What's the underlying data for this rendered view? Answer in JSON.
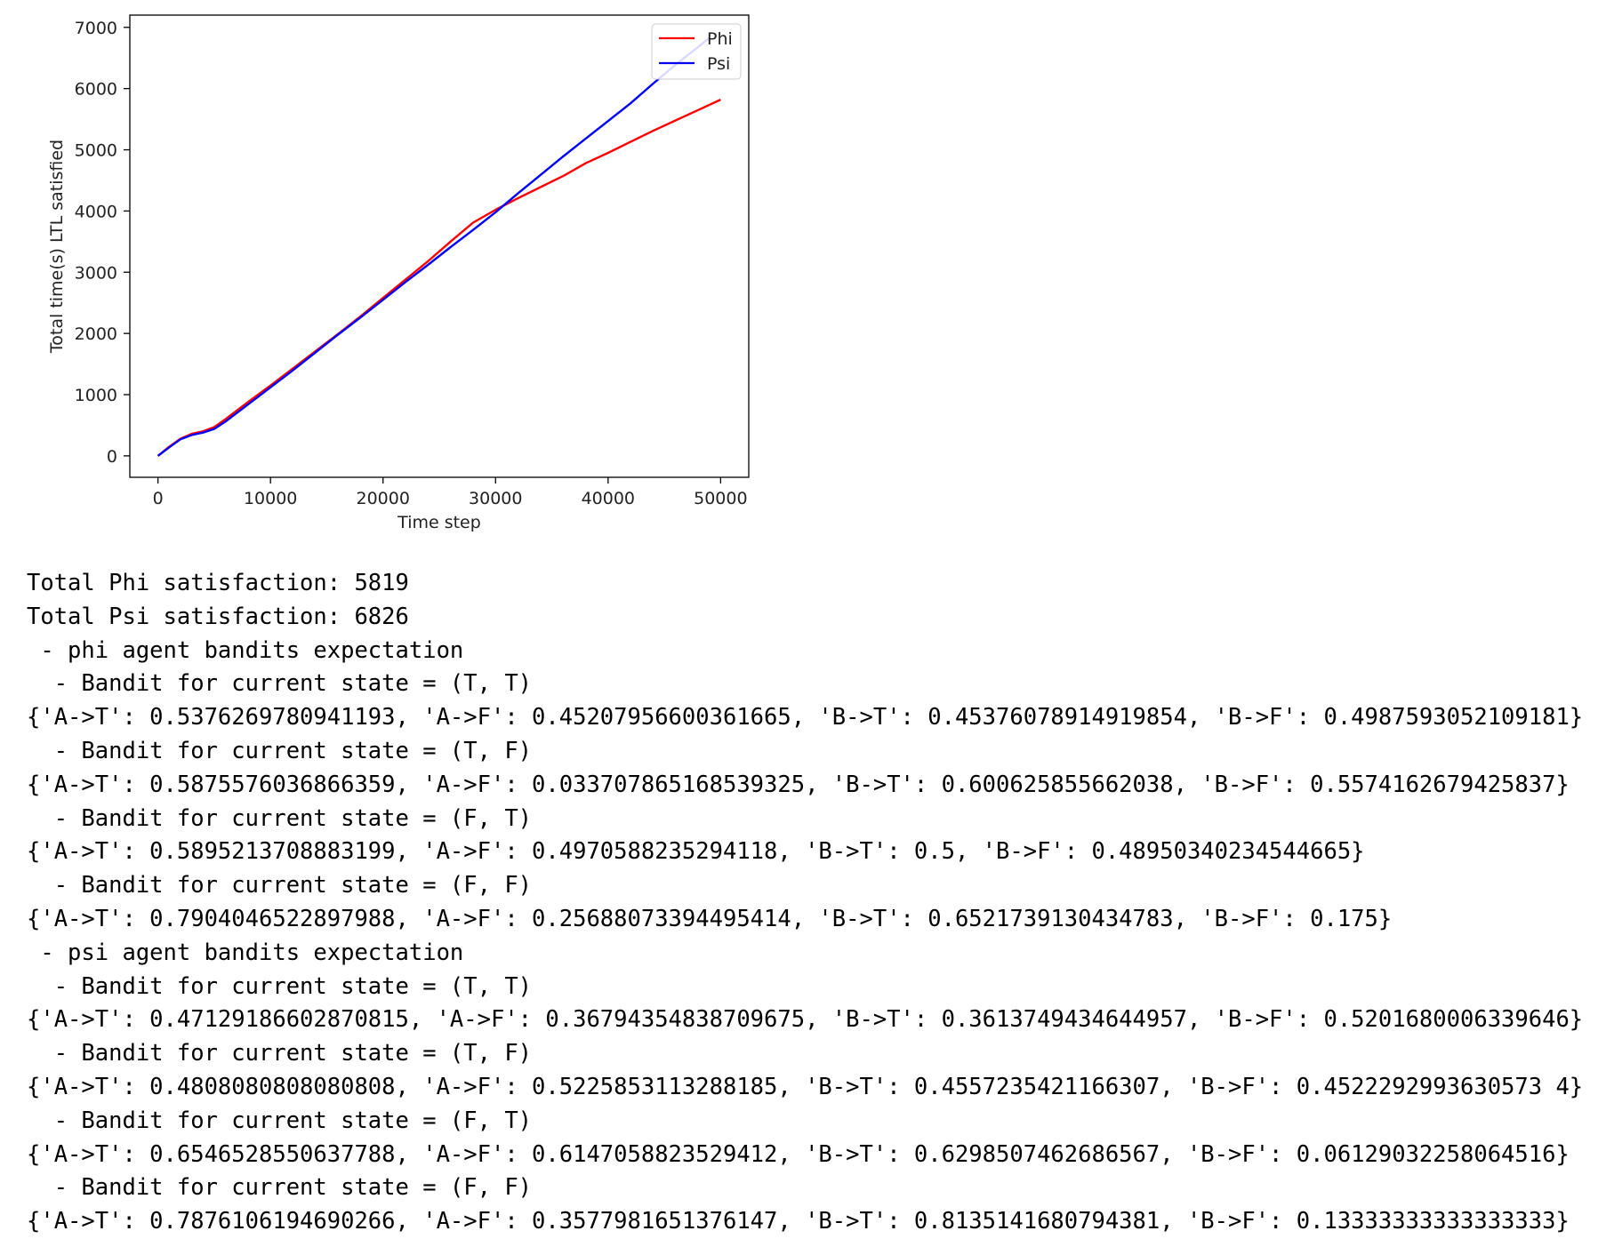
{
  "chart_data": {
    "type": "line",
    "xlabel": "Time step",
    "ylabel": "Total time(s) LTL satisfied",
    "xlim": [
      -2500,
      52500
    ],
    "ylim": [
      -350,
      7200
    ],
    "xticks": [
      0,
      10000,
      20000,
      30000,
      40000,
      50000
    ],
    "yticks": [
      0,
      1000,
      2000,
      3000,
      4000,
      5000,
      6000,
      7000
    ],
    "legend_position": "top-right",
    "grid": false,
    "series": [
      {
        "name": "Phi",
        "color": "#ff0000",
        "x": [
          0,
          1000,
          2000,
          3000,
          4000,
          5000,
          6000,
          8000,
          10000,
          12000,
          14000,
          16000,
          18000,
          20000,
          22000,
          24000,
          26000,
          28000,
          30000,
          32000,
          34000,
          36000,
          38000,
          40000,
          42000,
          44000,
          46000,
          48000,
          50000
        ],
        "y": [
          0,
          150,
          280,
          360,
          400,
          470,
          600,
          880,
          1150,
          1430,
          1710,
          1990,
          2280,
          2580,
          2880,
          3180,
          3500,
          3810,
          4020,
          4210,
          4390,
          4570,
          4780,
          4950,
          5130,
          5310,
          5480,
          5650,
          5819
        ]
      },
      {
        "name": "Psi",
        "color": "#0000ff",
        "x": [
          0,
          1000,
          2000,
          3000,
          4000,
          5000,
          6000,
          8000,
          10000,
          12000,
          14000,
          16000,
          18000,
          20000,
          22000,
          24000,
          26000,
          28000,
          30000,
          32000,
          34000,
          36000,
          38000,
          40000,
          42000,
          44000,
          46000,
          48000,
          49000
        ],
        "y": [
          0,
          140,
          270,
          340,
          380,
          440,
          560,
          840,
          1120,
          1400,
          1690,
          1980,
          2260,
          2550,
          2840,
          3120,
          3410,
          3690,
          3980,
          4290,
          4590,
          4890,
          5180,
          5470,
          5760,
          6080,
          6390,
          6680,
          6826
        ]
      }
    ]
  },
  "output_lines": [
    "Total Phi satisfaction: 5819",
    "Total Psi satisfaction: 6826",
    " - phi agent bandits expectation",
    "  - Bandit for current state = (T, T)",
    "{'A->T': 0.5376269780941193, 'A->F': 0.45207956600361665, 'B->T': 0.45376078914919854, 'B->F': 0.4987593052109181}",
    "  - Bandit for current state = (T, F)",
    "{'A->T': 0.5875576036866359, 'A->F': 0.033707865168539325, 'B->T': 0.600625855662038, 'B->F': 0.5574162679425837}",
    "  - Bandit for current state = (F, T)",
    "{'A->T': 0.5895213708883199, 'A->F': 0.4970588235294118, 'B->T': 0.5, 'B->F': 0.48950340234544665}",
    "  - Bandit for current state = (F, F)",
    "{'A->T': 0.7904046522897988, 'A->F': 0.25688073394495414, 'B->T': 0.6521739130434783, 'B->F': 0.175}",
    " - psi agent bandits expectation",
    "  - Bandit for current state = (T, T)",
    "{'A->T': 0.47129186602870815, 'A->F': 0.36794354838709675, 'B->T': 0.3613749434644957, 'B->F': 0.5201680006339646}",
    "  - Bandit for current state = (T, F)",
    "{'A->T': 0.4808080808080808, 'A->F': 0.5225853113288185, 'B->T': 0.4557235421166307, 'B->F': 0.4522292993630573 4}",
    "  - Bandit for current state = (F, T)",
    "{'A->T': 0.6546528550637788, 'A->F': 0.6147058823529412, 'B->T': 0.6298507462686567, 'B->F': 0.06129032258064516}",
    "  - Bandit for current state = (F, F)",
    "{'A->T': 0.7876106194690266, 'A->F': 0.3577981651376147, 'B->T': 0.8135141680794381, 'B->F': 0.13333333333333333}"
  ]
}
